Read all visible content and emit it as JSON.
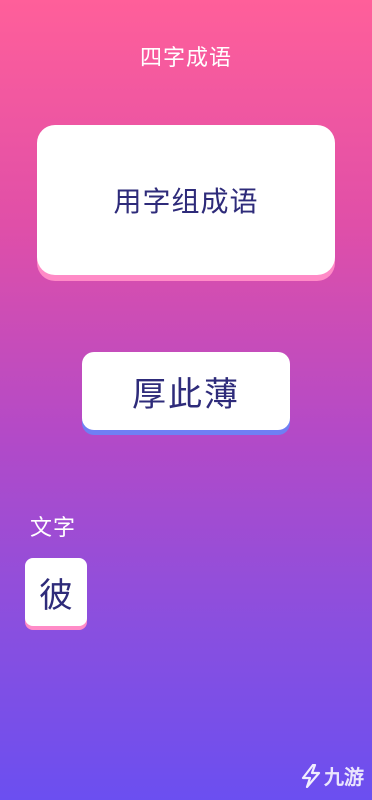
{
  "header": {
    "title": "四字成语"
  },
  "prompt": {
    "text": "用字组成语"
  },
  "answer": {
    "text": "厚此薄"
  },
  "characters": {
    "label": "文字",
    "items": [
      {
        "char": "彼"
      }
    ]
  },
  "watermark": {
    "text": "九游",
    "icon": "lightning-icon"
  },
  "colors": {
    "bg_top": "#ff5f9a",
    "bg_bottom": "#6b4ff0",
    "card_text": "#2e2b7a",
    "card_shadow_pink": "#ff8bc7",
    "card_shadow_blue": "#6f7ff4"
  }
}
